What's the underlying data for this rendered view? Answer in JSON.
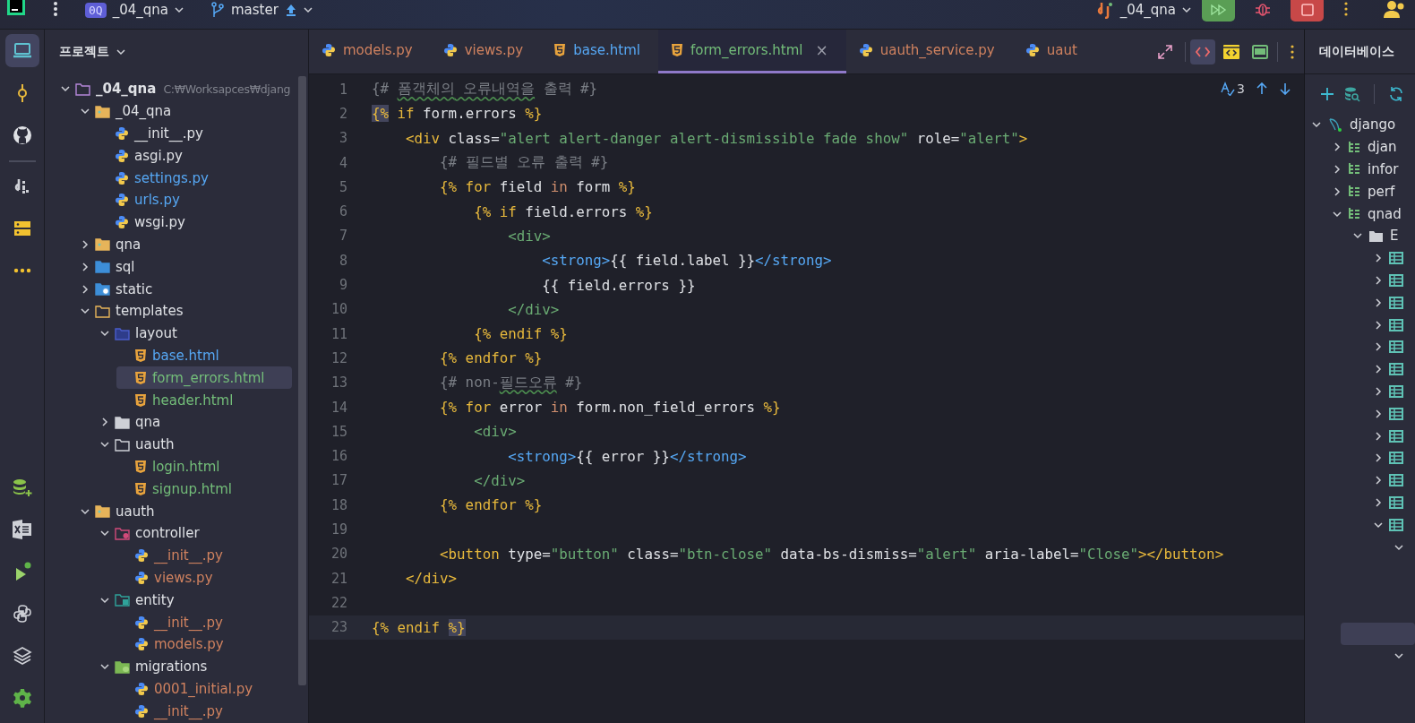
{
  "top_bar": {
    "project_badge": "0Q",
    "project": "_04_qna",
    "branch": "master",
    "run_config": "_04_qna"
  },
  "tool_strip": {
    "top": [
      {
        "kind": "project",
        "selected": true
      },
      {
        "kind": "commit",
        "selected": false
      },
      {
        "kind": "github",
        "selected": false
      },
      {
        "kind": "divider"
      },
      {
        "kind": "django",
        "selected": false
      },
      {
        "kind": "services",
        "selected": false
      },
      {
        "kind": "more",
        "selected": false
      }
    ],
    "bottom": [
      {
        "kind": "db-add",
        "selected": false
      },
      {
        "kind": "excel",
        "selected": false
      },
      {
        "kind": "run",
        "selected": false
      },
      {
        "kind": "python",
        "selected": false
      },
      {
        "kind": "layers",
        "selected": false
      },
      {
        "kind": "settings",
        "selected": false
      }
    ]
  },
  "project_panel": {
    "title": "프로젝트",
    "tree": [
      {
        "name": "_04_qna",
        "path": "C:₩Worksapces₩djang",
        "kind": "module",
        "expanded": true,
        "selected": false,
        "color": "#dfe1e5",
        "children": [
          {
            "name": "_04_qna",
            "kind": "package",
            "expanded": true,
            "selected": false,
            "color": "#dfe1e5",
            "children": [
              {
                "name": "__init__.py",
                "kind": "py",
                "selected": false,
                "color": "#dfe1e5"
              },
              {
                "name": "asgi.py",
                "kind": "py",
                "selected": false,
                "color": "#dfe1e5"
              },
              {
                "name": "settings.py",
                "kind": "py",
                "selected": false,
                "color": "#56a8f5"
              },
              {
                "name": "urls.py",
                "kind": "py",
                "selected": false,
                "color": "#56a8f5"
              },
              {
                "name": "wsgi.py",
                "kind": "py",
                "selected": false,
                "color": "#dfe1e5"
              }
            ]
          },
          {
            "name": "qna",
            "kind": "package",
            "expanded": false,
            "selected": false,
            "color": "#dfe1e5"
          },
          {
            "name": "sql",
            "kind": "sql",
            "expanded": false,
            "selected": false,
            "color": "#dfe1e5"
          },
          {
            "name": "static",
            "kind": "web",
            "expanded": false,
            "selected": false,
            "color": "#dfe1e5"
          },
          {
            "name": "templates",
            "kind": "templates",
            "expanded": true,
            "selected": false,
            "color": "#dfe1e5",
            "children": [
              {
                "name": "layout",
                "kind": "layout",
                "expanded": true,
                "selected": false,
                "color": "#dfe1e5",
                "children": [
                  {
                    "name": "base.html",
                    "kind": "html",
                    "selected": false,
                    "color": "#56a8f5"
                  },
                  {
                    "name": "form_errors.html",
                    "kind": "html",
                    "selected": true,
                    "color": "#73bd79"
                  },
                  {
                    "name": "header.html",
                    "kind": "html",
                    "selected": false,
                    "color": "#73bd79"
                  }
                ]
              },
              {
                "name": "qna",
                "kind": "plain",
                "expanded": false,
                "selected": false,
                "color": "#dfe1e5"
              },
              {
                "name": "uauth",
                "kind": "outline",
                "expanded": true,
                "selected": false,
                "color": "#dfe1e5",
                "children": [
                  {
                    "name": "login.html",
                    "kind": "html",
                    "selected": false,
                    "color": "#73bd79"
                  },
                  {
                    "name": "signup.html",
                    "kind": "html",
                    "selected": false,
                    "color": "#73bd79"
                  }
                ]
              }
            ]
          },
          {
            "name": "uauth",
            "kind": "package",
            "expanded": true,
            "selected": false,
            "color": "#dfe1e5",
            "children": [
              {
                "name": "controller",
                "kind": "controller",
                "expanded": true,
                "selected": false,
                "color": "#dfe1e5",
                "children": [
                  {
                    "name": "__init__.py",
                    "kind": "py",
                    "selected": false,
                    "color": "#d0825f"
                  },
                  {
                    "name": "views.py",
                    "kind": "py",
                    "selected": false,
                    "color": "#d0825f"
                  }
                ]
              },
              {
                "name": "entity",
                "kind": "entity",
                "expanded": true,
                "selected": false,
                "color": "#dfe1e5",
                "children": [
                  {
                    "name": "__init__.py",
                    "kind": "py",
                    "selected": false,
                    "color": "#d0825f"
                  },
                  {
                    "name": "models.py",
                    "kind": "py",
                    "selected": false,
                    "color": "#d0825f"
                  }
                ]
              },
              {
                "name": "migrations",
                "kind": "migrations",
                "expanded": true,
                "selected": false,
                "color": "#dfe1e5",
                "children": [
                  {
                    "name": "0001_initial.py",
                    "kind": "py",
                    "selected": false,
                    "color": "#d0825f"
                  },
                  {
                    "name": "__init__.py",
                    "kind": "py",
                    "selected": false,
                    "color": "#d0825f"
                  }
                ]
              }
            ]
          }
        ]
      }
    ]
  },
  "editor": {
    "tabs": [
      {
        "label": "models.py",
        "kind": "py",
        "selected": false,
        "color": "#d0825f"
      },
      {
        "label": "views.py",
        "kind": "py",
        "selected": false,
        "color": "#d0825f"
      },
      {
        "label": "base.html",
        "kind": "html",
        "selected": false,
        "color": "#56a8f5"
      },
      {
        "label": "form_errors.html",
        "kind": "html",
        "selected": true,
        "color": "#73bd79",
        "close": "×"
      },
      {
        "label": "uauth_service.py",
        "kind": "py",
        "selected": false,
        "color": "#d0825f"
      },
      {
        "label": "uaut",
        "kind": "py",
        "selected": false,
        "color": "#d0825f"
      }
    ],
    "view_modes": [
      {
        "kind": "code",
        "selected": true
      },
      {
        "kind": "preview",
        "selected": false
      },
      {
        "kind": "split",
        "selected": false
      }
    ],
    "problems": "3",
    "lines": [
      {
        "number": "1",
        "current": false,
        "tokens": [
          {
            "kind": "comment",
            "text": "{# "
          },
          {
            "kind": "typo",
            "text": "폼객체의"
          },
          {
            "kind": "typo",
            "text": " 오류내역을"
          },
          {
            "kind": "comment",
            "text": " 출력 #}"
          }
        ]
      },
      {
        "number": "2",
        "current": false,
        "tokens": [
          {
            "kind": "match",
            "text": "{%"
          },
          {
            "kind": "kw",
            "text": " if"
          },
          {
            "kind": "plain",
            "text": " form.errors "
          },
          {
            "kind": "brace",
            "text": "%}"
          }
        ]
      },
      {
        "number": "3",
        "current": false,
        "tokens": [
          {
            "kind": "tag",
            "text": "    <div"
          },
          {
            "kind": "plain",
            "text": " class="
          },
          {
            "kind": "str",
            "text": "\"alert alert-danger alert-dismissible fade show\""
          },
          {
            "kind": "plain",
            "text": " role="
          },
          {
            "kind": "str",
            "text": "\"alert\""
          },
          {
            "kind": "tag",
            "text": ">"
          }
        ]
      },
      {
        "number": "4",
        "current": false,
        "tokens": [
          {
            "kind": "comment",
            "text": "        {# 필드별 오류 출력 #}"
          }
        ]
      },
      {
        "number": "5",
        "current": false,
        "tokens": [
          {
            "kind": "brace",
            "text": "        {%"
          },
          {
            "kind": "kw",
            "text": " for"
          },
          {
            "kind": "plain",
            "text": " field "
          },
          {
            "kind": "op",
            "text": "in"
          },
          {
            "kind": "plain",
            "text": " form "
          },
          {
            "kind": "brace",
            "text": "%}"
          }
        ]
      },
      {
        "number": "6",
        "current": false,
        "tokens": [
          {
            "kind": "brace",
            "text": "            {%"
          },
          {
            "kind": "kw",
            "text": " if"
          },
          {
            "kind": "plain",
            "text": " field.errors "
          },
          {
            "kind": "brace",
            "text": "%}"
          }
        ]
      },
      {
        "number": "7",
        "current": false,
        "tokens": [
          {
            "kind": "tag2",
            "text": "                <div>"
          }
        ]
      },
      {
        "number": "8",
        "current": false,
        "tokens": [
          {
            "kind": "tag3",
            "text": "                    <strong>"
          },
          {
            "kind": "plain",
            "text": "{{ field.label }}"
          },
          {
            "kind": "tag3",
            "text": "</strong>"
          }
        ]
      },
      {
        "number": "9",
        "current": false,
        "tokens": [
          {
            "kind": "plain",
            "text": "                    {{ field.errors }}"
          }
        ]
      },
      {
        "number": "10",
        "current": false,
        "tokens": [
          {
            "kind": "tag2",
            "text": "                </div>"
          }
        ]
      },
      {
        "number": "11",
        "current": false,
        "tokens": [
          {
            "kind": "brace",
            "text": "            {%"
          },
          {
            "kind": "kw",
            "text": " endif"
          },
          {
            "kind": "brace",
            "text": " %}"
          }
        ]
      },
      {
        "number": "12",
        "current": false,
        "tokens": [
          {
            "kind": "brace",
            "text": "        {%"
          },
          {
            "kind": "kw",
            "text": " endfor"
          },
          {
            "kind": "brace",
            "text": " %}"
          }
        ]
      },
      {
        "number": "13",
        "current": false,
        "tokens": [
          {
            "kind": "comment",
            "text": "        {# non-"
          },
          {
            "kind": "typo",
            "text": "필드오류"
          },
          {
            "kind": "comment",
            "text": " #}"
          }
        ]
      },
      {
        "number": "14",
        "current": false,
        "tokens": [
          {
            "kind": "brace",
            "text": "        {%"
          },
          {
            "kind": "kw",
            "text": " for"
          },
          {
            "kind": "plain",
            "text": " error "
          },
          {
            "kind": "op",
            "text": "in"
          },
          {
            "kind": "plain",
            "text": " form.non_field_errors "
          },
          {
            "kind": "brace",
            "text": "%}"
          }
        ]
      },
      {
        "number": "15",
        "current": false,
        "tokens": [
          {
            "kind": "tag2",
            "text": "            <div>"
          }
        ]
      },
      {
        "number": "16",
        "current": false,
        "tokens": [
          {
            "kind": "tag3",
            "text": "                <strong>"
          },
          {
            "kind": "plain",
            "text": "{{ error }}"
          },
          {
            "kind": "tag3",
            "text": "</strong>"
          }
        ]
      },
      {
        "number": "17",
        "current": false,
        "tokens": [
          {
            "kind": "tag2",
            "text": "            </div>"
          }
        ]
      },
      {
        "number": "18",
        "current": false,
        "tokens": [
          {
            "kind": "brace",
            "text": "        {%"
          },
          {
            "kind": "kw",
            "text": " endfor"
          },
          {
            "kind": "brace",
            "text": " %}"
          }
        ]
      },
      {
        "number": "19",
        "current": false
      },
      {
        "number": "20",
        "current": false,
        "tokens": [
          {
            "kind": "tag",
            "text": "        <button"
          },
          {
            "kind": "plain",
            "text": " type="
          },
          {
            "kind": "str",
            "text": "\"button\""
          },
          {
            "kind": "plain",
            "text": " class="
          },
          {
            "kind": "str",
            "text": "\"btn-close\""
          },
          {
            "kind": "plain",
            "text": " data-bs-dismiss="
          },
          {
            "kind": "str",
            "text": "\"alert\""
          },
          {
            "kind": "plain",
            "text": " aria-label="
          },
          {
            "kind": "str",
            "text": "\"Close\""
          },
          {
            "kind": "tag",
            "text": "></button>"
          }
        ]
      },
      {
        "number": "21",
        "current": false,
        "tokens": [
          {
            "kind": "tag",
            "text": "    </div>"
          }
        ]
      },
      {
        "number": "22",
        "current": false
      },
      {
        "number": "23",
        "current": true,
        "tokens": [
          {
            "kind": "brace",
            "text": "{%"
          },
          {
            "kind": "kw",
            "text": " endif "
          },
          {
            "kind": "match",
            "text": "%}"
          }
        ]
      }
    ]
  },
  "database_panel": {
    "title": "데이터베이스",
    "tree": [
      {
        "name": "django",
        "kind": "datasource",
        "expanded": true,
        "selected": false,
        "children": [
          {
            "name": "djan",
            "kind": "schema",
            "expanded": false,
            "selected": false
          },
          {
            "name": "infor",
            "kind": "schema",
            "expanded": false,
            "selected": false
          },
          {
            "name": "perf",
            "kind": "schema",
            "expanded": false,
            "selected": false
          },
          {
            "name": "qnad",
            "kind": "schema",
            "expanded": true,
            "selected": false,
            "children": [
              {
                "name": "E",
                "kind": "folder",
                "expanded": true,
                "selected": false,
                "children": [
                  {
                    "kind": "table",
                    "expanded": false,
                    "selected": false
                  },
                  {
                    "kind": "table",
                    "expanded": false,
                    "selected": false
                  },
                  {
                    "kind": "table",
                    "expanded": false,
                    "selected": false
                  },
                  {
                    "kind": "table",
                    "expanded": false,
                    "selected": false
                  },
                  {
                    "kind": "table",
                    "expanded": false,
                    "selected": false
                  },
                  {
                    "kind": "table",
                    "expanded": false,
                    "selected": false
                  },
                  {
                    "kind": "table",
                    "expanded": false,
                    "selected": false
                  },
                  {
                    "kind": "table",
                    "expanded": false,
                    "selected": false
                  },
                  {
                    "kind": "table",
                    "expanded": false,
                    "selected": false
                  },
                  {
                    "kind": "table",
                    "expanded": false,
                    "selected": false
                  },
                  {
                    "kind": "table",
                    "expanded": false,
                    "selected": false
                  },
                  {
                    "kind": "table",
                    "expanded": false,
                    "selected": false
                  },
                  {
                    "kind": "table",
                    "expanded": true,
                    "selected": false,
                    "children": [
                      {
                        "expanded": true,
                        "selected": false
                      },
                      {
                        "selected": true
                      },
                      {
                        "expanded": true,
                        "selected": false
                      }
                    ]
                  }
                ]
              }
            ]
          }
        ]
      }
    ]
  }
}
